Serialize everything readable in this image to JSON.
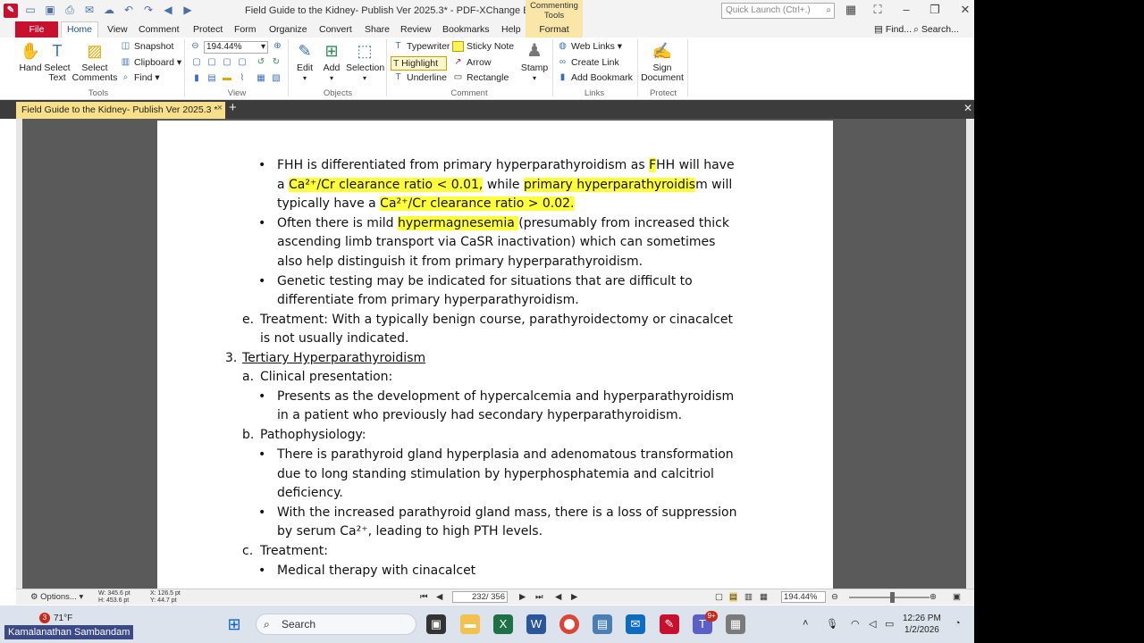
{
  "window": {
    "title": "Field Guide to the Kidney- Publish Ver 2025.3* - PDF-XChange Editor",
    "context_tab_header": "Commenting Tools",
    "quick_launch_placeholder": "Quick Launch (Ctrl+.)"
  },
  "ribbon_tabs": [
    "File",
    "Home",
    "View",
    "Comment",
    "Protect",
    "Form",
    "Organize",
    "Convert",
    "Share",
    "Review",
    "Bookmarks",
    "Help",
    "Format"
  ],
  "ribbon_right": {
    "find": "Find...",
    "search": "Search..."
  },
  "ribbon": {
    "tools": {
      "hand": "Hand",
      "select_text": "Select Text",
      "select_comments": "Select Comments",
      "snapshot": "Snapshot",
      "clipboard": "Clipboard",
      "find": "Find",
      "label": "Tools"
    },
    "view": {
      "zoom": "194.44%",
      "label": "View"
    },
    "objects": {
      "edit": "Edit",
      "add": "Add",
      "selection": "Selection",
      "label": "Objects"
    },
    "comment": {
      "typewriter": "Typewriter",
      "sticky_note": "Sticky Note",
      "highlight": "Highlight",
      "arrow": "Arrow",
      "underline": "Underline",
      "rectangle": "Rectangle",
      "stamp": "Stamp",
      "label": "Comment"
    },
    "links": {
      "web_links": "Web Links",
      "create_link": "Create Link",
      "add_bookmark": "Add Bookmark",
      "label": "Links"
    },
    "protect": {
      "sign_document": "Sign Document",
      "label": "Protect"
    }
  },
  "doc_tab": {
    "label": "Field Guide to the Kidney- Publish Ver 2025.3 *"
  },
  "document": {
    "l1a": "FHH is differentiated from primary hyperparathyroidism as ",
    "l1b": "F",
    "l1c": "HH will have",
    "l2a": "a ",
    "l2b": "Ca²⁺/Cr clearance ratio < 0.01,",
    "l2c": " while ",
    "l2d": "primary hyperparathyroidis",
    "l2e": "m will",
    "l3a": "typically have a ",
    "l3b": "Ca²⁺/Cr clearance ratio > 0.02.",
    "l4a": "Often there is mild ",
    "l4b": "hypermagnesemia ",
    "l4c": "(presumably from increased thick",
    "l5": "ascending limb transport via CaSR inactivation) which can sometimes",
    "l6": "also help distinguish it from primary hyperparathyroidism.",
    "l7": "Genetic testing may be indicated for situations that are difficult to",
    "l8": "differentiate from primary hyperparathyroidism.",
    "l9_marker": "e.",
    "l9": "Treatment: With a typically benign course, parathyroidectomy or cinacalcet",
    "l10": "is not usually indicated.",
    "l11_marker": "3.",
    "l11": "Tertiary Hyperparathyroidism",
    "l12_marker": "a.",
    "l12": "Clinical presentation:",
    "l13": "Presents as the development of hypercalcemia and hyperparathyroidism",
    "l14": "in a patient who previously had secondary hyperparathyroidism.",
    "l15_marker": "b.",
    "l15": "Pathophysiology:",
    "l16": "There is parathyroid gland hyperplasia and adenomatous transformation",
    "l17": "due to long standing stimulation by hyperphosphatemia and calcitriol",
    "l18": "deficiency.",
    "l19": "With the increased parathyroid gland mass, there is a loss of suppression",
    "l20": "by serum Ca²⁺, leading to high PTH levels.",
    "l21_marker": "c.",
    "l21": "Treatment:",
    "l22": "Medical therapy with cinacalcet",
    "bullet": "•"
  },
  "statusbar": {
    "options": "Options...",
    "w": "W: 345.6 pt",
    "h": "H: 453.6 pt",
    "x": "X: 126.5 pt",
    "y": "Y: 44.7 pt",
    "page": "232",
    "page_total": "/ 356",
    "zoom": "194.44%"
  },
  "taskbar": {
    "search": "Search",
    "weather": "71°F",
    "weather_badge": "3",
    "teams_badge": "9+",
    "time": "12:26 PM",
    "date": "1/2/2026"
  },
  "caption": "Kamalanathan Sambandam"
}
